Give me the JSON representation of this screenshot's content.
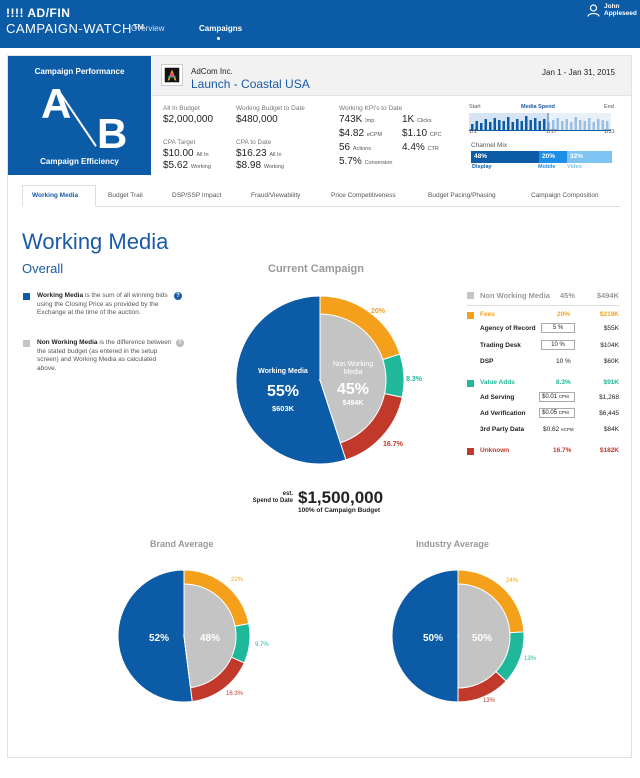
{
  "app": {
    "brand_line1": "!!!! AD/FIN",
    "brand_line2": "CAMPAIGN-WATCH™",
    "nav": [
      "Overview",
      "Campaigns"
    ],
    "user_first": "John",
    "user_last": "Appleseed"
  },
  "ab_panel": {
    "top": "Campaign Performance",
    "letter_a": "A",
    "letter_b": "B",
    "bottom": "Campaign Efficiency"
  },
  "campaign": {
    "advertiser": "AdCom Inc.",
    "name": "Launch - Coastal USA",
    "dates": "Jan 1 - Jan 31, 2015"
  },
  "budget": {
    "all_in_budget_label": "All In Budget",
    "all_in_budget": "$2,000,000",
    "working_budget_label": "Working Budget to Date",
    "working_budget": "$480,000",
    "cpa_target_label": "CPA Target",
    "cpa_target_1": "$10.00",
    "cpa_target_1_suffix": "All In",
    "cpa_target_2": "$5.62",
    "cpa_target_2_suffix": "Working",
    "cpa_to_date_label": "CPA to Date",
    "cpa_to_date_1": "$16.23",
    "cpa_to_date_1_suffix": "All In",
    "cpa_to_date_2": "$8.98",
    "cpa_to_date_2_suffix": "Working"
  },
  "kpis": {
    "label": "Working KPI's to Date",
    "items": [
      {
        "value": "743K",
        "unit": "Imp."
      },
      {
        "value": "1K",
        "unit": "Clicks"
      },
      {
        "value": "$4.82",
        "unit": "eCPM"
      },
      {
        "value": "$1.10",
        "unit": "CPC"
      },
      {
        "value": "56",
        "unit": "Actions"
      },
      {
        "value": "4.4%",
        "unit": "CTR"
      },
      {
        "value": "5.7%",
        "unit": "Conversion"
      }
    ]
  },
  "timeline": {
    "start": "Start",
    "title": "Media Spend",
    "end": "End",
    "tick_start": "1/1",
    "tick_mid": "1/17",
    "tick_end": "1/31"
  },
  "channel_mix": {
    "label": "Channel Mix",
    "segments": [
      {
        "pct": "48%",
        "name": "Display",
        "share": 0.48,
        "color": "#0c5ba6"
      },
      {
        "pct": "20%",
        "name": "Mobile",
        "share": 0.2,
        "color": "#1e8ee8"
      },
      {
        "pct": "32%",
        "name": "Video",
        "share": 0.32,
        "color": "#7dc4f2"
      }
    ]
  },
  "tabs": [
    "Working Media",
    "Budget Trail",
    "DSP/SSP Impact",
    "Fraud/Viewability",
    "Price Competitiveness",
    "Budget Pacing/Phasing",
    "Campaign Composition"
  ],
  "main": {
    "title": "Working Media",
    "subtitle": "Overall",
    "current_campaign": "Current Campaign",
    "brand_average": "Brand Average",
    "industry_average": "Industry Average"
  },
  "legend": {
    "working_bold": "Working Media",
    "working_l1": " is the sum of all winning bids",
    "working_l2": "using the Closing Price as provided by the",
    "working_l3": "Exchange at the time of the auction.",
    "non_bold": "Non Working Media",
    "non_l1": " is the difference between",
    "non_l2": "the stated budget (as entered in the setup",
    "non_l3": "screen) and Working Media as calculated",
    "non_l4": "above."
  },
  "current_pie": {
    "working_label": "Working Media",
    "working_pct": "55%",
    "working_amt": "$603K",
    "non_label_1": "Non Working",
    "non_label_2": "Media",
    "non_pct": "45%",
    "non_amt": "$494K",
    "fees_pct": "20%",
    "value_pct": "8.3%",
    "unknown_pct": "16.7%"
  },
  "breakdown": {
    "nonworking": {
      "label": "Non Working Media",
      "pct": "45%",
      "amt": "$494K"
    },
    "fees": {
      "label": "Fees",
      "pct": "20%",
      "amt": "$219K"
    },
    "agency": {
      "label": "Agency of Record",
      "input": "5 %",
      "amt": "$55K"
    },
    "trading": {
      "label": "Trading Desk",
      "input": "10 %",
      "amt": "$104K"
    },
    "dsp": {
      "label": "DSP",
      "value": "10 %",
      "amt": "$60K"
    },
    "valueadds": {
      "label": "Value Adds",
      "pct": "8.3%",
      "amt": "$91K"
    },
    "adserving": {
      "label": "Ad Serving",
      "input": "$0.01",
      "unit": "CPM",
      "amt": "$1,268"
    },
    "adverif": {
      "label": "Ad Verification",
      "input": "$0.05",
      "unit": "CPM",
      "amt": "$6,445"
    },
    "thirdparty": {
      "label": "3rd Party Data",
      "value": "$0.62",
      "unit": "eCPM",
      "amt": "$84K"
    },
    "unknown": {
      "label": "Unknown",
      "pct": "16.7%",
      "amt": "$182K"
    }
  },
  "spend": {
    "est_1": "est.",
    "est_2": "Spend to Date",
    "value": "$1,500,000",
    "sub": "100% of Campaign Budget"
  },
  "brand_pie": {
    "working": "52%",
    "non": "48%",
    "fees": "22%",
    "value": "9.7%",
    "unknown": "16.3%"
  },
  "industry_pie": {
    "working": "50%",
    "non": "50%",
    "fees": "24%",
    "value": "13%",
    "unknown": "13%"
  },
  "colors": {
    "blue": "#0c5ba6",
    "gray": "#c4c4c4",
    "orange": "#f5a01a",
    "teal": "#1fb89a",
    "red": "#c0392b"
  }
}
